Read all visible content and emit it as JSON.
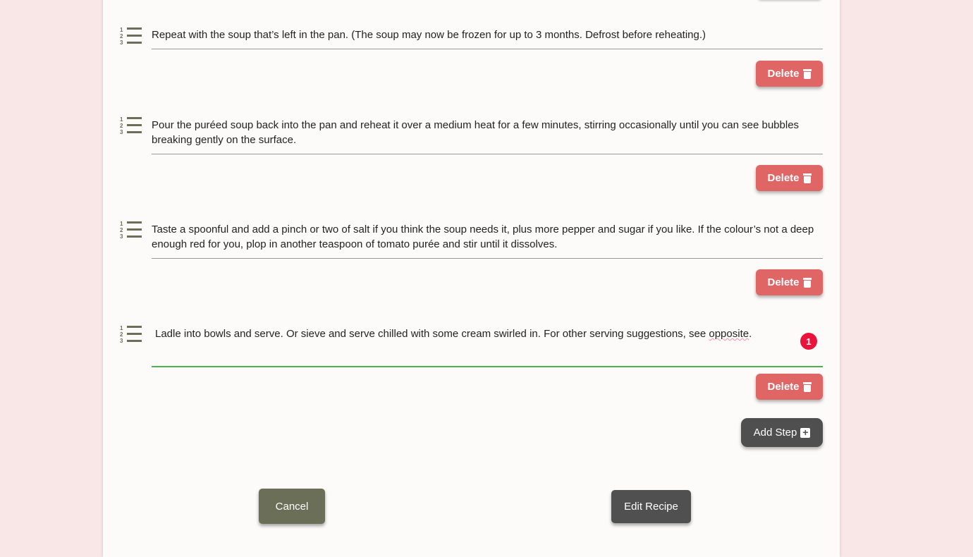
{
  "steps": [
    {
      "text": "Repeat with the soup that’s left in the pan. (The soup may now be frozen for up to 3 months. Defrost before reheating.)",
      "delete_label": "Delete"
    },
    {
      "text": "Pour the puréed soup back into the pan and reheat it over a medium heat for a few minutes, stirring occasionally until you can see bubbles breaking gently on the surface.",
      "delete_label": "Delete"
    },
    {
      "text": "Taste a spoonful and add a pinch or two of salt if you think the soup needs it, plus more pepper and sugar if you like. If the colour’s not a deep enough red for you, plop in another teaspoon of tomato purée and stir until it dissolves.",
      "delete_label": "Delete"
    },
    {
      "text_before": "Ladle into bowls and serve. Or sieve and serve chilled with some cream swirled in. For other serving suggestions, see ",
      "text_misspelled": "opposite",
      "text_after": ".",
      "delete_label": "Delete"
    }
  ],
  "spellcheck_badge": "1",
  "add_step_label": "Add Step",
  "cancel_label": "Cancel",
  "edit_recipe_label": "Edit Recipe"
}
